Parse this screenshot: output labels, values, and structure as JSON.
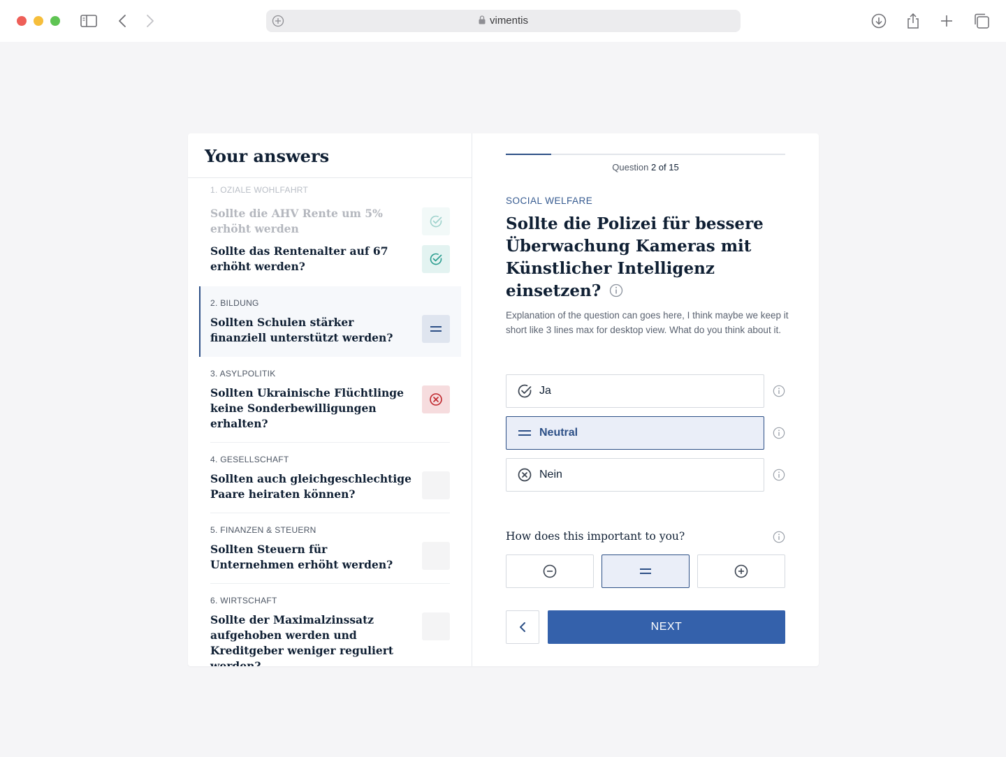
{
  "browser": {
    "url": "vimentis"
  },
  "sidebar": {
    "title": "Your answers",
    "sections": [
      {
        "category": "1. OZIALE WOHLFAHRT",
        "questions": [
          {
            "text": "Sollte die AHV Rente um 5% erhöht werden",
            "answer": "yes"
          },
          {
            "text": "Sollte das Rentenalter auf 67 erhöht werden?",
            "answer": "yes"
          }
        ]
      },
      {
        "category": "2. BILDUNG",
        "question": "Sollten Schulen stärker finanziell unterstützt werden?",
        "answer": "neutral"
      },
      {
        "category": "3. ASYLPOLITIK",
        "question": "Sollten Ukrainische Flüchtlinge keine Sonderbewilligungen erhalten?",
        "answer": "no"
      },
      {
        "category": "4. GESELLSCHAFT",
        "question": "Sollten auch gleichgeschlechtige Paare heiraten können?",
        "answer": "none"
      },
      {
        "category": "5. FINANZEN & STEUERN",
        "question": "Sollten Steuern für Unternehmen erhöht werden?",
        "answer": "none"
      },
      {
        "category": "6. WIRTSCHAFT",
        "question": "Sollte der Maximalzinssatz aufgehoben werden und Kreditgeber weniger reguliert werden?",
        "answer": "none"
      }
    ]
  },
  "progress": {
    "prefix": "Question",
    "current_of_total": "2 of 15",
    "fraction": 0.1625
  },
  "question": {
    "category": "SOCIAL WELFARE",
    "title": "Sollte die Polizei für bessere Überwachung Kameras mit Künstlicher Intelligenz einsetzen?",
    "explanation": "Explanation of the question can goes here, I think maybe we keep it short like 3 lines max for desktop view. What do you think about it."
  },
  "options": [
    {
      "label": "Ja",
      "icon": "check-circle-icon",
      "selected": false
    },
    {
      "label": "Neutral",
      "icon": "equals-icon",
      "selected": true
    },
    {
      "label": "Nein",
      "icon": "x-circle-icon",
      "selected": false
    }
  ],
  "importance": {
    "label": "How does this important to you?",
    "selected": "neutral"
  },
  "nav": {
    "next_label": "NEXT"
  },
  "colors": {
    "primary": "#3461ab",
    "accent_teal": "#2a9d8f",
    "danger": "#c0272d"
  }
}
